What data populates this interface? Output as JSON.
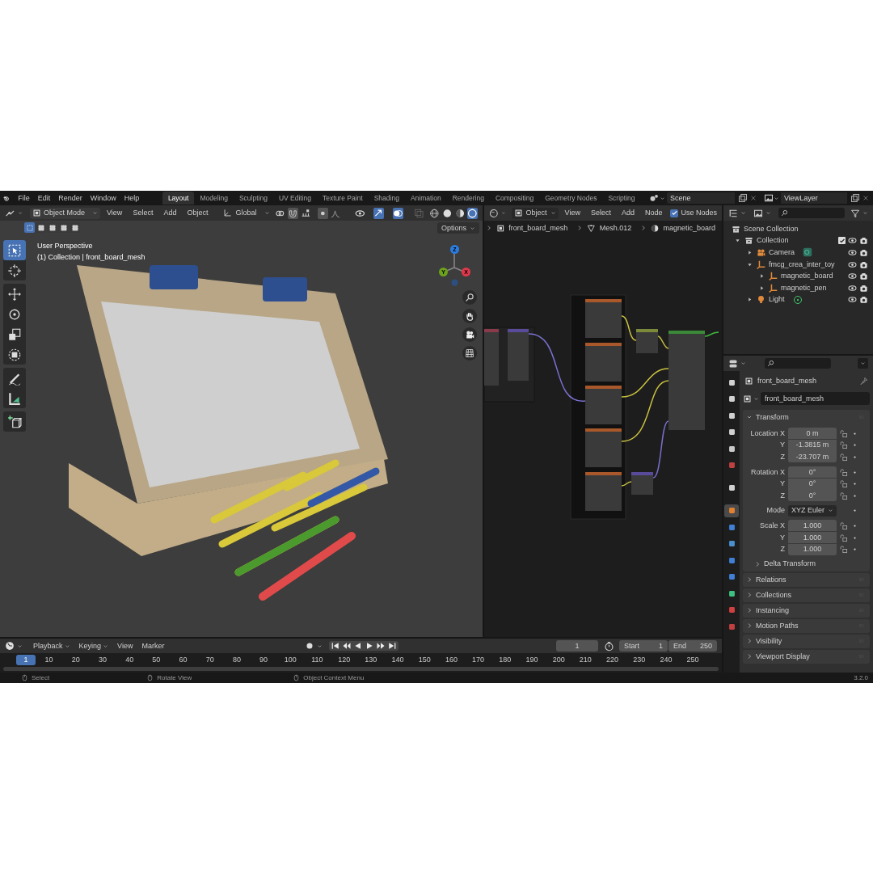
{
  "top_bar": {
    "menus": [
      "File",
      "Edit",
      "Render",
      "Window",
      "Help"
    ],
    "workspaces": [
      {
        "label": "Layout",
        "selected": true
      },
      {
        "label": "Modeling",
        "selected": false
      },
      {
        "label": "Sculpting",
        "selected": false
      },
      {
        "label": "UV Editing",
        "selected": false
      },
      {
        "label": "Texture Paint",
        "selected": false
      },
      {
        "label": "Shading",
        "selected": false
      },
      {
        "label": "Animation",
        "selected": false
      },
      {
        "label": "Rendering",
        "selected": false
      },
      {
        "label": "Compositing",
        "selected": false
      },
      {
        "label": "Geometry Nodes",
        "selected": false
      },
      {
        "label": "Scripting",
        "selected": false
      }
    ],
    "scene": "Scene",
    "view_layer": "ViewLayer"
  },
  "viewport": {
    "mode": "Object Mode",
    "menus": [
      "View",
      "Select",
      "Add",
      "Object"
    ],
    "orientation": "Global",
    "options": "Options",
    "select_modes": [
      {
        "selected": true
      },
      {
        "selected": false
      },
      {
        "selected": false
      },
      {
        "selected": false
      },
      {
        "selected": false
      }
    ],
    "overlay_title": "User Perspective",
    "overlay_subtitle": "(1) Collection | front_board_mesh",
    "tool_groups": [
      [
        {
          "kind": "select-box",
          "selected": true
        },
        {
          "kind": "cursor",
          "selected": false
        }
      ],
      [
        {
          "kind": "move",
          "selected": false
        },
        {
          "kind": "rotate",
          "selected": false
        },
        {
          "kind": "scale",
          "selected": false
        },
        {
          "kind": "transform",
          "selected": false
        }
      ],
      [
        {
          "kind": "annotate",
          "selected": false
        },
        {
          "kind": "measure",
          "selected": false
        }
      ],
      [
        {
          "kind": "add-cube",
          "selected": false
        }
      ]
    ],
    "gizmo": [
      {
        "label": "Z",
        "color": "#2c7de0"
      },
      {
        "label": "Y",
        "color": "#6ca21c"
      },
      {
        "label": "X",
        "color": "#e0384a"
      }
    ]
  },
  "node_editor": {
    "object": "Object",
    "menus": [
      "View",
      "Select",
      "Add",
      "Node"
    ],
    "use_nodes": {
      "label": "Use Nodes",
      "checked": true
    },
    "breadcrumbs": [
      {
        "kind": "object",
        "label": "front_board_mesh"
      },
      {
        "kind": "mesh",
        "label": "Mesh.012"
      },
      {
        "kind": "material",
        "label": "magnetic_board"
      }
    ]
  },
  "outliner": {
    "root": "Scene Collection",
    "items": [
      {
        "kind": "collection",
        "label": "Collection",
        "expanded": true,
        "checked": true,
        "children": [
          {
            "kind": "camera",
            "label": "Camera",
            "expanded": false
          },
          {
            "kind": "empty",
            "label": "fmcg_crea_inter_toy",
            "expanded": true,
            "children": [
              {
                "kind": "empty",
                "label": "magnetic_board",
                "expanded": false
              },
              {
                "kind": "empty",
                "label": "magnetic_pen",
                "expanded": false
              }
            ]
          },
          {
            "kind": "light",
            "label": "Light",
            "expanded": false
          }
        ]
      }
    ]
  },
  "properties": {
    "tabs": [
      {
        "color": "#d0d0d0",
        "selected": false
      },
      {
        "color": "#d0d0d0",
        "selected": false
      },
      {
        "color": "#d0d0d0",
        "selected": false
      },
      {
        "color": "#d0d0d0",
        "selected": false
      },
      {
        "color": "#c8c8c8",
        "selected": false
      },
      {
        "color": "#c04040",
        "selected": false
      },
      {
        "color": "#d0d0d0",
        "selected": false
      },
      {
        "color": "#e08030",
        "selected": true
      },
      {
        "color": "#3f7fd6",
        "selected": false
      },
      {
        "color": "#4a90d0",
        "selected": false
      },
      {
        "color": "#3f7fd6",
        "selected": false
      },
      {
        "color": "#3f7fd6",
        "selected": false
      },
      {
        "color": "#3fbf7f",
        "selected": false
      },
      {
        "color": "#d04040",
        "selected": false
      },
      {
        "color": "#c04040",
        "selected": false
      }
    ],
    "object_name": "front_board_mesh",
    "data_name": "front_board_mesh",
    "transform": {
      "title": "Transform",
      "expanded": true,
      "groups": [
        {
          "kind": "vector",
          "rows": [
            {
              "label": "Location X",
              "value": "0 m"
            },
            {
              "label": "Y",
              "value": "-1.3815 m"
            },
            {
              "label": "Z",
              "value": "-23.707 m"
            }
          ]
        },
        {
          "kind": "vector",
          "rows": [
            {
              "label": "Rotation X",
              "value": "0°"
            },
            {
              "label": "Y",
              "value": "0°"
            },
            {
              "label": "Z",
              "value": "0°"
            }
          ]
        },
        {
          "kind": "dropdown",
          "label": "Mode",
          "value": "XYZ Euler"
        },
        {
          "kind": "vector",
          "rows": [
            {
              "label": "Scale X",
              "value": "1.000"
            },
            {
              "label": "Y",
              "value": "1.000"
            },
            {
              "label": "Z",
              "value": "1.000"
            }
          ]
        }
      ],
      "subpanel": {
        "label": "Delta Transform",
        "expanded": false
      }
    },
    "panels": [
      {
        "label": "Relations",
        "expanded": false
      },
      {
        "label": "Collections",
        "expanded": false
      },
      {
        "label": "Instancing",
        "expanded": false
      },
      {
        "label": "Motion Paths",
        "expanded": false
      },
      {
        "label": "Visibility",
        "expanded": false
      },
      {
        "label": "Viewport Display",
        "expanded": false
      }
    ]
  },
  "timeline": {
    "menus": [
      {
        "label": "Playback",
        "dropdown": true
      },
      {
        "label": "Keying",
        "dropdown": true
      },
      {
        "label": "View",
        "dropdown": false
      },
      {
        "label": "Marker",
        "dropdown": false
      }
    ],
    "current_frame": "1",
    "start_label": "Start",
    "start": "1",
    "end_label": "End",
    "end": "250",
    "ticks": [
      {
        "label": "1",
        "selected": true
      },
      {
        "label": "10",
        "selected": false
      },
      {
        "label": "20",
        "selected": false
      },
      {
        "label": "30",
        "selected": false
      },
      {
        "label": "40",
        "selected": false
      },
      {
        "label": "50",
        "selected": false
      },
      {
        "label": "60",
        "selected": false
      },
      {
        "label": "70",
        "selected": false
      },
      {
        "label": "80",
        "selected": false
      },
      {
        "label": "90",
        "selected": false
      },
      {
        "label": "100",
        "selected": false
      },
      {
        "label": "110",
        "selected": false
      },
      {
        "label": "120",
        "selected": false
      },
      {
        "label": "130",
        "selected": false
      },
      {
        "label": "140",
        "selected": false
      },
      {
        "label": "150",
        "selected": false
      },
      {
        "label": "160",
        "selected": false
      },
      {
        "label": "170",
        "selected": false
      },
      {
        "label": "180",
        "selected": false
      },
      {
        "label": "190",
        "selected": false
      },
      {
        "label": "200",
        "selected": false
      },
      {
        "label": "210",
        "selected": false
      },
      {
        "label": "220",
        "selected": false
      },
      {
        "label": "230",
        "selected": false
      },
      {
        "label": "240",
        "selected": false
      },
      {
        "label": "250",
        "selected": false
      }
    ]
  },
  "status_bar": {
    "hints": [
      "Select",
      "Rotate View",
      "Object Context Menu"
    ],
    "version": "3.2.0"
  }
}
